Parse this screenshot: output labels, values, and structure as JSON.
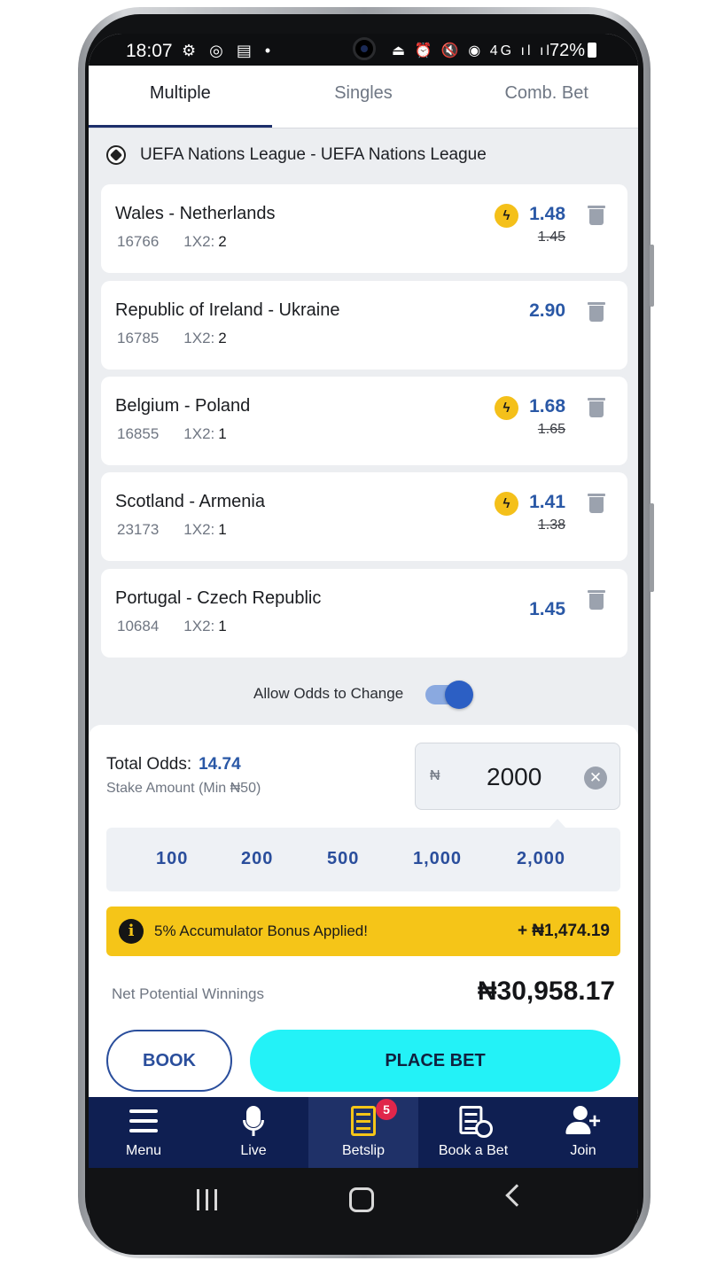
{
  "status_bar": {
    "time": "18:07",
    "left_icons": "⚙ ◎ ▤ •",
    "right_icons": "⏏ ⏰ 🔇 ◉ 4G ıl ıl",
    "battery": "72%"
  },
  "tabs": [
    {
      "label": "Multiple",
      "active": true
    },
    {
      "label": "Singles",
      "active": false
    },
    {
      "label": "Comb. Bet",
      "active": false
    }
  ],
  "league": "UEFA Nations League - UEFA Nations League",
  "bets": [
    {
      "match": "Wales - Netherlands",
      "id": "16766",
      "market": "1X2:",
      "pick": "2",
      "odd": "1.48",
      "old_odd": "1.45",
      "boost": true
    },
    {
      "match": "Republic of Ireland - Ukraine",
      "id": "16785",
      "market": "1X2:",
      "pick": "2",
      "odd": "2.90",
      "old_odd": "",
      "boost": false
    },
    {
      "match": "Belgium - Poland",
      "id": "16855",
      "market": "1X2:",
      "pick": "1",
      "odd": "1.68",
      "old_odd": "1.65",
      "boost": true
    },
    {
      "match": "Scotland - Armenia",
      "id": "23173",
      "market": "1X2:",
      "pick": "1",
      "odd": "1.41",
      "old_odd": "1.38",
      "boost": true
    },
    {
      "match": "Portugal - Czech Republic",
      "id": "10684",
      "market": "1X2:",
      "pick": "1",
      "odd": "1.45",
      "old_odd": "",
      "boost": false
    }
  ],
  "allow_odds": {
    "label": "Allow Odds to Change",
    "enabled": true
  },
  "summary": {
    "total_odds_label": "Total Odds:",
    "total_odds": "14.74",
    "stake_min": "Stake Amount (Min ₦50)",
    "currency": "₦",
    "stake": "2000",
    "quick_stakes": [
      "100",
      "200",
      "500",
      "1,000",
      "2,000"
    ],
    "bonus_text": "5% Accumulator Bonus Applied!",
    "bonus_amount": "+ ₦1,474.19",
    "net_label": "Net Potential Winnings",
    "net_value": "₦30,958.17",
    "book_label": "BOOK",
    "place_label": "PLACE BET"
  },
  "nav": {
    "menu": "Menu",
    "live": "Live",
    "betslip": "Betslip",
    "betslip_count": "5",
    "book_a_bet": "Book a Bet",
    "join": "Join"
  },
  "colors": {
    "accent_blue": "#2a58a6",
    "nav_bg": "#0f1f52",
    "bonus_yellow": "#f5c518",
    "place_bet_cyan": "#23f2f7"
  }
}
